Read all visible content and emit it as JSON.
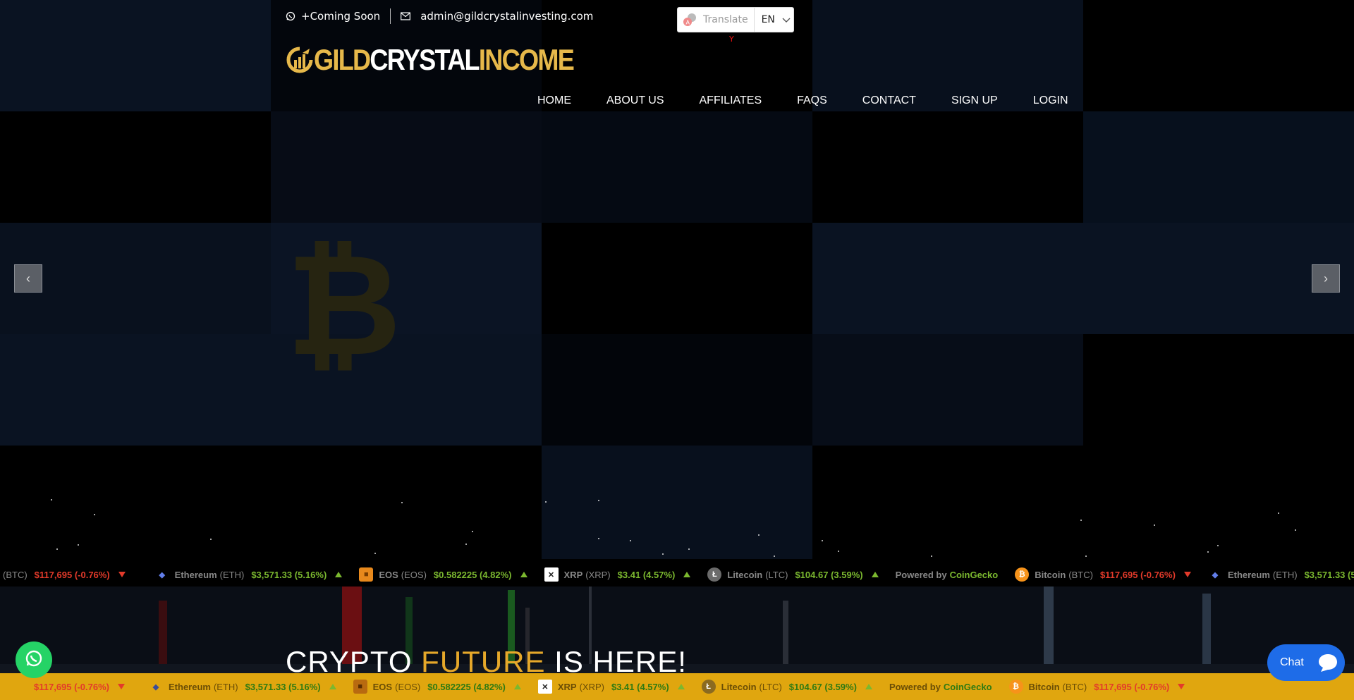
{
  "topbar": {
    "phone": "+Coming Soon",
    "email": "admin@gildcrystalinvesting.com",
    "icons": [
      "whatsapp-icon",
      "envelope-icon"
    ]
  },
  "translate": {
    "label": "Translate",
    "lang": "EN",
    "y_mark": "Y"
  },
  "logo": {
    "gild": "GILD",
    "crystal": "CRYSTAL",
    "income": "INCOME"
  },
  "nav": {
    "items": [
      "HOME",
      "ABOUT US",
      "AFFILIATES",
      "FAQS",
      "CONTACT",
      "SIGN UP",
      "LOGIN"
    ]
  },
  "slider": {
    "prev": "‹",
    "next": "›"
  },
  "ticker": {
    "coins": [
      {
        "name": "Bitcoin",
        "symbol": "(BTC)",
        "price": "$117,695",
        "change": "(-0.76%)",
        "direction": "down",
        "icon_color": "#f7931a",
        "glyph": "₿"
      },
      {
        "name": "Ethereum",
        "symbol": "(ETH)",
        "price": "$3,571.33",
        "change": "(5.16%)",
        "direction": "up",
        "icon_color": "#627eea",
        "glyph": "◆"
      },
      {
        "name": "EOS",
        "symbol": "(EOS)",
        "price": "$0.582225",
        "change": "(4.82%)",
        "direction": "up",
        "icon_color": "#e8891c",
        "glyph": "■"
      },
      {
        "name": "XRP",
        "symbol": "(XRP)",
        "price": "$3.41",
        "change": "(4.57%)",
        "direction": "up",
        "icon_color": "#ffffff",
        "glyph": "✕"
      },
      {
        "name": "Litecoin",
        "symbol": "(LTC)",
        "price": "$104.67",
        "change": "(3.59%)",
        "direction": "up",
        "icon_color": "#6b6b6b",
        "glyph": "Ł"
      }
    ],
    "powered_by": "Powered by",
    "powered_brand": "CoinGecko"
  },
  "lower": {
    "headline_a": "CRYPTO ",
    "headline_accent": "FUTURE",
    "headline_b": " IS HERE!"
  },
  "chat": {
    "label": "Chat"
  },
  "colors": {
    "gold": "#e6b84a",
    "ticker_bar": "#e0a60f",
    "up": "#7bb82f",
    "down": "#e33a2a",
    "chat": "#1e6ce8",
    "whatsapp": "#25d366"
  }
}
